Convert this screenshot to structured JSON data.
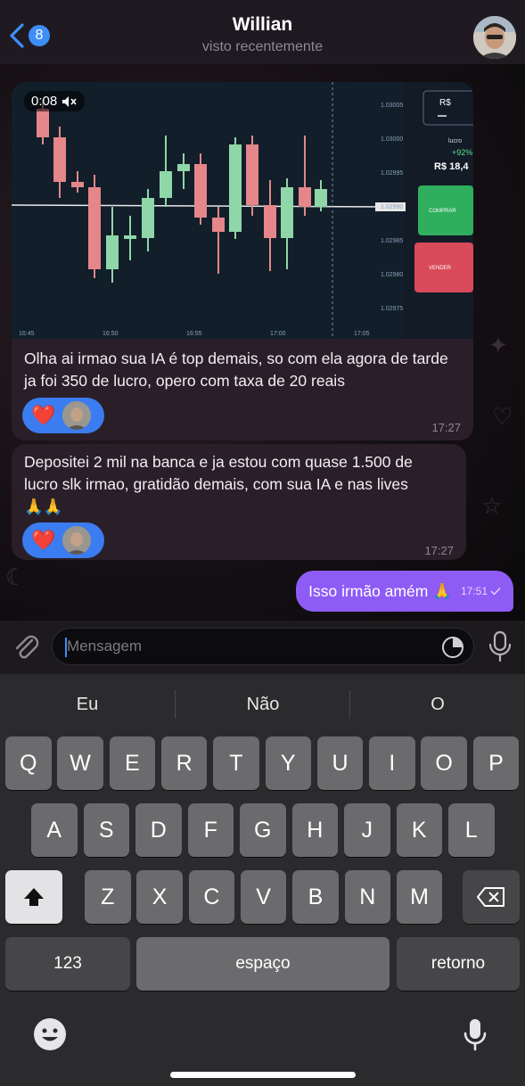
{
  "header": {
    "back_count": "8",
    "contact_name": "Willian",
    "status": "visto recentemente"
  },
  "messages": [
    {
      "video_duration": "0:08",
      "text": "Olha ai irmao sua IA é top demais, so com ela agora de tarde ja foi 350 de lucro, opero com taxa de 20 reais",
      "time": "17:27",
      "reaction": "❤️"
    },
    {
      "text_line1": "Depositei 2 mil na banca e ja estou com quase 1.500 de",
      "text_line2": "lucro slk irmao, gratidão demais, com sua IA e nas lives",
      "emoji": "🙏🙏",
      "time": "17:27",
      "reaction": "❤️"
    }
  ],
  "outgoing": {
    "text": "Isso irmão amém 🙏",
    "time": "17:51"
  },
  "input": {
    "placeholder": "Mensagem"
  },
  "keyboard": {
    "suggestions": [
      "Eu",
      "Não",
      "O"
    ],
    "row1": [
      "Q",
      "W",
      "E",
      "R",
      "T",
      "Y",
      "U",
      "I",
      "O",
      "P"
    ],
    "row2": [
      "A",
      "S",
      "D",
      "F",
      "G",
      "H",
      "J",
      "K",
      "L"
    ],
    "row3": [
      "Z",
      "X",
      "C",
      "V",
      "B",
      "N",
      "M"
    ],
    "numbers_label": "123",
    "space_label": "espaço",
    "return_label": "retorno"
  },
  "video_chart": {
    "price_labels": [
      "1.03005",
      "1.03000",
      "1.02995",
      "1.02990",
      "1.02985",
      "1.02980",
      "1.02975"
    ],
    "time_labels": [
      "16:45",
      "16:50",
      "16:55",
      "17:00",
      "17:05"
    ],
    "panel_currency": "R$",
    "panel_lucro_label": "lucro",
    "panel_percent": "+92%",
    "panel_value": "R$ 18,4",
    "buy_label": "COMPRAR",
    "sell_label": "VENDER",
    "colors": {
      "up": "#8fd6a8",
      "down": "#e4868a",
      "buy": "#2fae5d",
      "sell": "#d94a5a"
    }
  }
}
